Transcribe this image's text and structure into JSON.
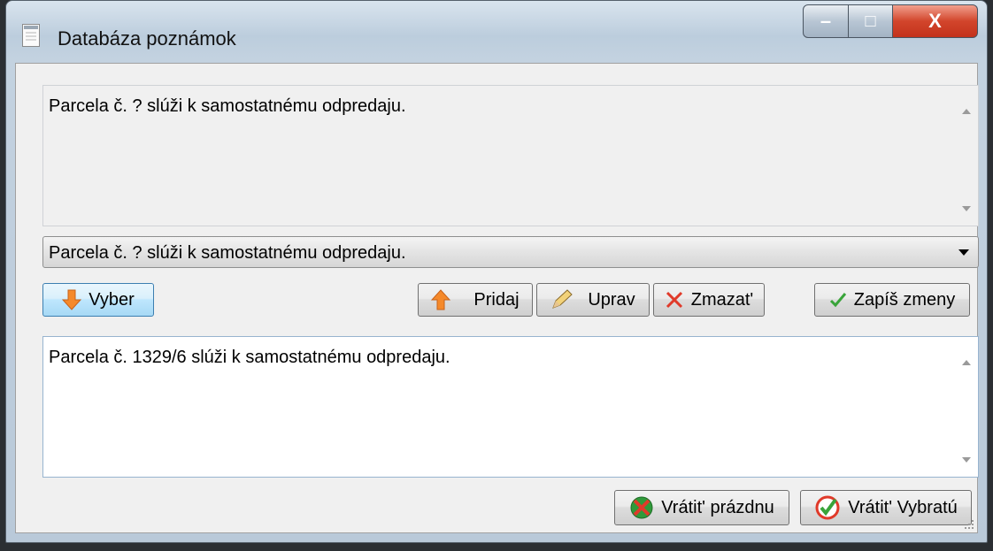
{
  "window": {
    "title": "Databáza poznámok",
    "buttons": {
      "minimize": "–",
      "maximize": "□",
      "close": "X"
    }
  },
  "preview": {
    "text": "Parcela č. ? slúži k samostatnému odpredaju."
  },
  "combo": {
    "selected": "Parcela č. ? slúži k samostatnému odpredaju."
  },
  "toolbar": {
    "select_label": "Vyber",
    "add_label": "Pridaj",
    "edit_label": "Uprav",
    "delete_label": "Zmazat'",
    "save_label": "Zapíš zmeny"
  },
  "editor": {
    "text": "Parcela č. 1329/6 slúži k samostatnému odpredaju."
  },
  "footer": {
    "return_empty_label": "Vrátit' prázdnu",
    "return_selected_label": "Vrátit' Vybratú"
  },
  "icons": {
    "select": "arrow-down-icon",
    "add": "arrow-up-icon",
    "edit": "pencil-icon",
    "delete": "x-icon",
    "save": "checkmark-icon",
    "return_empty": "cancel-icon",
    "return_selected": "check-circle-icon"
  },
  "colors": {
    "accent_orange": "#f5892a",
    "delete_red": "#e03a2a",
    "check_green": "#39a43a"
  }
}
